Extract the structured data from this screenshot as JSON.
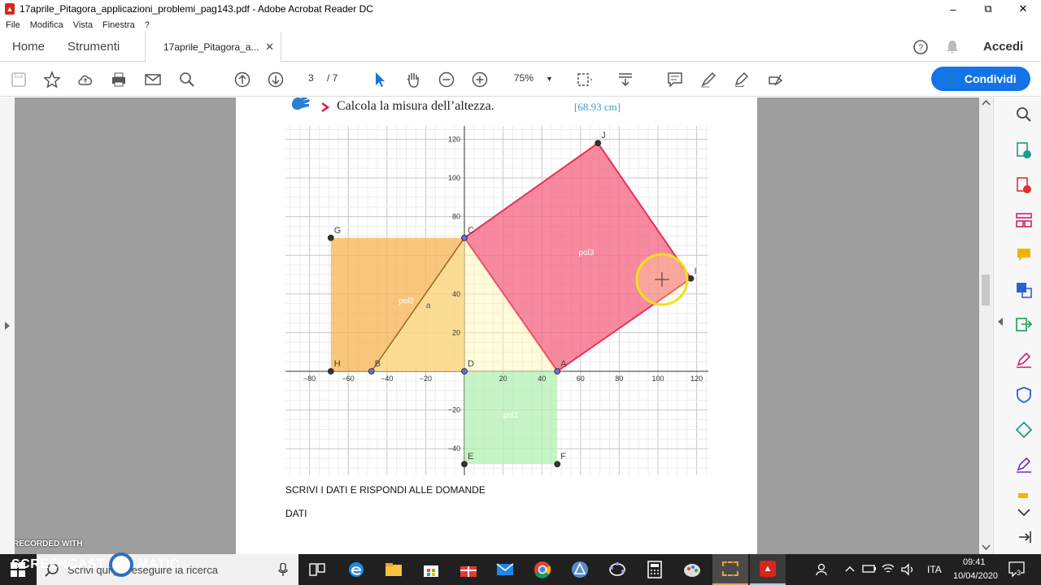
{
  "window": {
    "title": "17aprile_Pitagora_applicazioni_problemi_pag143.pdf - Adobe Acrobat Reader DC",
    "minimize": "–",
    "maximize": "⧉",
    "close": "✕"
  },
  "menu": [
    "File",
    "Modifica",
    "Vista",
    "Finestra",
    "?"
  ],
  "tabs": {
    "home": "Home",
    "tools": "Strumenti",
    "doc": "17aprile_Pitagora_a...",
    "close": "✕",
    "signin": "Accedi"
  },
  "toolbar": {
    "page_current": "3",
    "page_total": "/ 7",
    "zoom": "75%",
    "share": "Condividi"
  },
  "doc": {
    "prompt": "Calcola la misura dell’altezza.",
    "answer": "[68.93 cm]",
    "instructions": "SCRIVI I DATI E RISPONDI ALLE DOMANDE",
    "dati": "DATI"
  },
  "chart_data": {
    "type": "scatter",
    "title": "",
    "x_ticks": [
      "−80",
      "−60",
      "−40",
      "−20",
      "20",
      "40",
      "60",
      "80",
      "100",
      "120"
    ],
    "y_ticks": [
      "120",
      "100",
      "80",
      "40",
      "20",
      "−20",
      "−40"
    ],
    "xlim": [
      -93,
      126
    ],
    "ylim": [
      -53,
      130
    ],
    "points": [
      {
        "name": "J",
        "x": 69,
        "y": 118
      },
      {
        "name": "G",
        "x": -69,
        "y": 69
      },
      {
        "name": "C",
        "x": 0,
        "y": 69
      },
      {
        "name": "I",
        "x": 117,
        "y": 48
      },
      {
        "name": "H",
        "x": -69,
        "y": 0
      },
      {
        "name": "B",
        "x": -48,
        "y": 0
      },
      {
        "name": "D",
        "x": 0,
        "y": 0
      },
      {
        "name": "A",
        "x": 48,
        "y": 0
      },
      {
        "name": "E",
        "x": 0,
        "y": -48
      },
      {
        "name": "F",
        "x": 48,
        "y": -48
      }
    ],
    "polygons": [
      {
        "name": "pol2",
        "color": "#f5b451",
        "vertices": [
          "G",
          "C",
          "D",
          "H"
        ]
      },
      {
        "name": "pol3",
        "color": "#f4637f",
        "vertices": [
          "C",
          "J",
          "I",
          "A"
        ]
      },
      {
        "name": "pol1",
        "color": "#b4f0b4",
        "vertices": [
          "D",
          "A",
          "F",
          "E"
        ]
      }
    ],
    "segments": [
      {
        "name": "a",
        "from": "B",
        "to": "C"
      }
    ]
  },
  "taskbar": {
    "search": "Scrivi qui per eseguire la ricerca",
    "lang": "ITA",
    "time": "09:41",
    "date": "10/04/2020",
    "notifications": "3"
  },
  "watermark": {
    "line1": "RECORDED WITH",
    "line2": "SCREENCAST",
    "line3": "MATIC"
  }
}
